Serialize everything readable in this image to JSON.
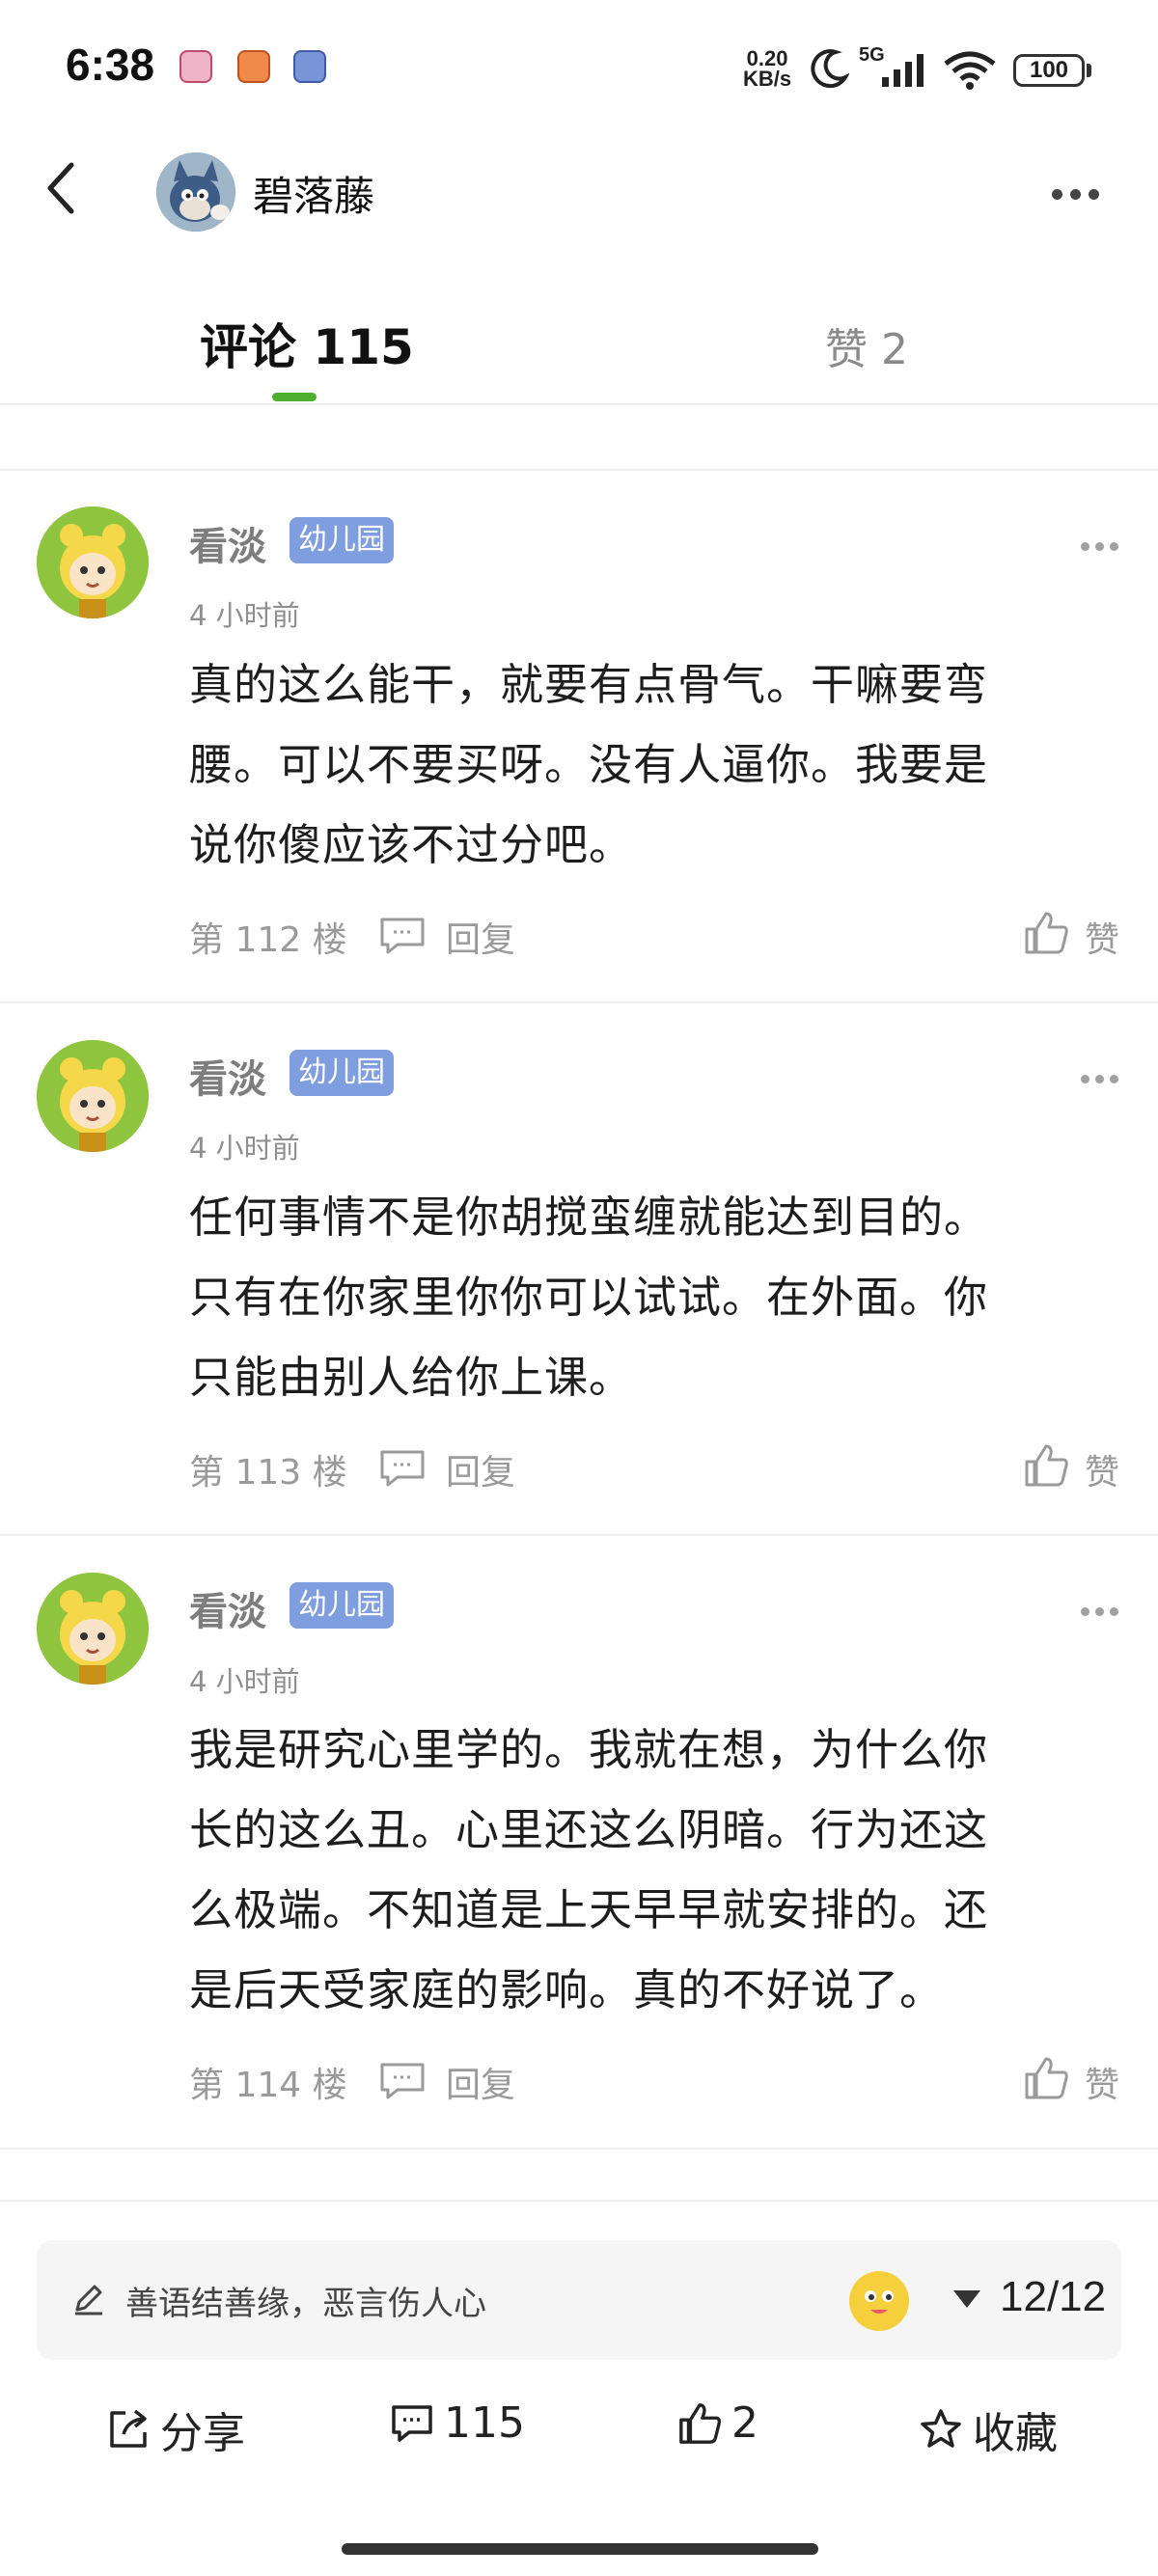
{
  "status_bar": {
    "time": "6:38",
    "net_speed_value": "0.20",
    "net_speed_unit": "KB/s",
    "signal": "5G",
    "battery": "100"
  },
  "header": {
    "username": "碧落藤"
  },
  "tabs": {
    "comments": "评论 115",
    "likes": "赞 2"
  },
  "comments": [
    {
      "author": "看淡",
      "badge": "幼儿园",
      "time": "4 小时前",
      "lines": [
        "真的这么能干，就要有点骨气。干嘛要弯",
        "腰。可以不要买呀。没有人逼你。我要是",
        "说你傻应该不过分吧。"
      ],
      "floor": "第 112 楼",
      "reply": "回复",
      "like": "赞"
    },
    {
      "author": "看淡",
      "badge": "幼儿园",
      "time": "4 小时前",
      "lines": [
        "任何事情不是你胡搅蛮缠就能达到目的。",
        "只有在你家里你你可以试试。在外面。你",
        "只能由别人给你上课。"
      ],
      "floor": "第 113 楼",
      "reply": "回复",
      "like": "赞"
    },
    {
      "author": "看淡",
      "badge": "幼儿园",
      "time": "4 小时前",
      "lines": [
        "我是研究心里学的。我就在想，为什么你",
        "长的这么丑。心里还这么阴暗。行为还这",
        "么极端。不知道是上天早早就安排的。还",
        "是后天受家庭的影响。真的不好说了。"
      ],
      "floor": "第 114 楼",
      "reply": "回复",
      "like": "赞"
    }
  ],
  "input": {
    "placeholder": "善语结善缘，恶言伤人心",
    "pager": "12/12"
  },
  "actions": {
    "share": "分享",
    "comments": "115",
    "likes": "2",
    "favorite": "收藏"
  }
}
